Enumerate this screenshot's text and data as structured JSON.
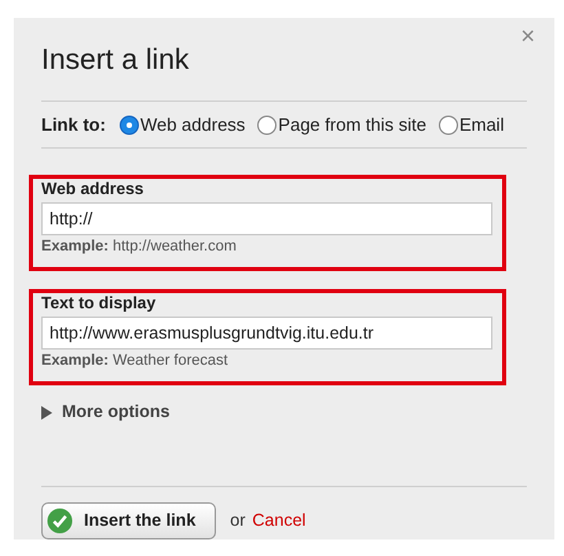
{
  "dialog": {
    "title": "Insert a link",
    "close": "×"
  },
  "link_to": {
    "label": "Link to:",
    "options": [
      {
        "label": "Web address",
        "selected": true
      },
      {
        "label": "Page from this site",
        "selected": false
      },
      {
        "label": "Email",
        "selected": false
      }
    ]
  },
  "fields": [
    {
      "label": "Web address",
      "value": "http://",
      "example_label": "Example:",
      "example": "http://weather.com",
      "highlighted": true
    },
    {
      "label": "Text to display",
      "value": "http://www.erasmusplusgrundtvig.itu.edu.tr",
      "example_label": "Example:",
      "example": "Weather forecast",
      "highlighted": true
    }
  ],
  "more_options": {
    "label": "More options",
    "expanded": false
  },
  "footer": {
    "button": "Insert the link",
    "or": "or",
    "cancel": "Cancel"
  }
}
